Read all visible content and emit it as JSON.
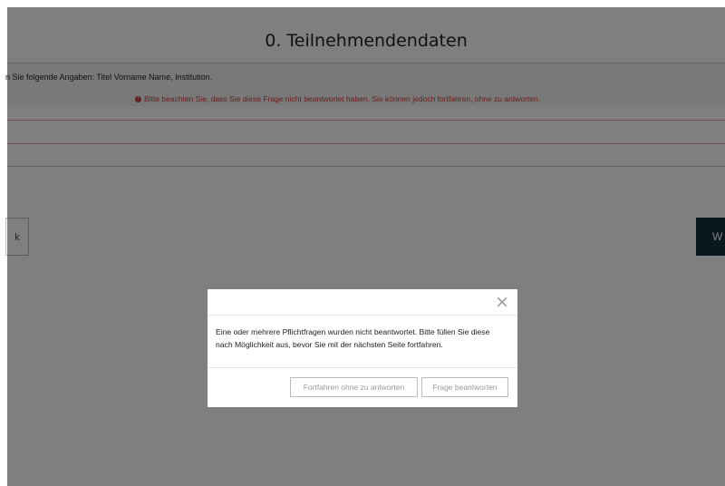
{
  "page": {
    "section_title": "0. Teilnehmendendaten",
    "question_text": "n Sie folgende Angaben: Titel Vorname Name, Institution.",
    "warning_icon": "!",
    "warning_text": "Bitte beachten Sie, dass Sie diese Frage nicht beantwortet haben. Sie können jedoch fortfahren, ohne zu antworten.",
    "back_button_label": "k",
    "next_button_label": "W"
  },
  "modal": {
    "close_glyph": "×",
    "message": "Eine oder mehrere Pflichtfragen wurden nicht beantwortet. Bitte füllen Sie diese nach Möglichkeit aus, bevor Sie mit der nächsten Seite fortfahren.",
    "continue_button_label": "Fortfahren ohne zu antworten",
    "answer_button_label": "Frage beantworten"
  },
  "colors": {
    "warning": "#d43a3a",
    "next_button": "#12303c",
    "overlay": "rgba(0,0,0,0.5)"
  },
  "icons": {
    "warning": "exclamation-circle-icon",
    "close": "close-icon"
  }
}
